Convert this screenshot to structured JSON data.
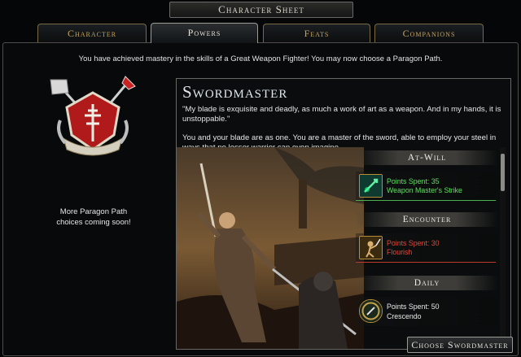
{
  "window": {
    "title": "Character Sheet"
  },
  "tabs": [
    {
      "label": "Character",
      "active": false
    },
    {
      "label": "Powers",
      "active": true
    },
    {
      "label": "Feats",
      "active": false
    },
    {
      "label": "Companions",
      "active": false
    }
  ],
  "notice": "You have achieved mastery in the skills of a Great Weapon Fighter! You may now choose a Paragon Path.",
  "sidebar": {
    "coming_soon_line1": "More Paragon Path",
    "coming_soon_line2": "choices coming soon!"
  },
  "path": {
    "name": "Swordmaster",
    "quote": "\"My blade is exquisite and deadly, as much a work of art as a weapon. And in my hands, it is unstoppable.\"",
    "description": "You and your blade are as one. You are a master of the sword, able to employ your steel in ways that no lesser warrior can even imagine."
  },
  "powers": {
    "at_will": {
      "header": "At-Will",
      "points": "Points Spent: 35",
      "name": "Weapon Master's Strike",
      "color": "#5ee05e",
      "icon": "sword-strike-icon"
    },
    "encounter": {
      "header": "Encounter",
      "points": "Points Spent: 30",
      "name": "Flourish",
      "color": "#e04a3c",
      "icon": "flourish-icon"
    },
    "daily": {
      "header": "Daily",
      "points": "Points Spent: 50",
      "name": "Crescendo",
      "color": "#e8e8e8",
      "icon": "daily-power-icon"
    }
  },
  "actions": {
    "choose_label": "Choose Swordmaster"
  }
}
